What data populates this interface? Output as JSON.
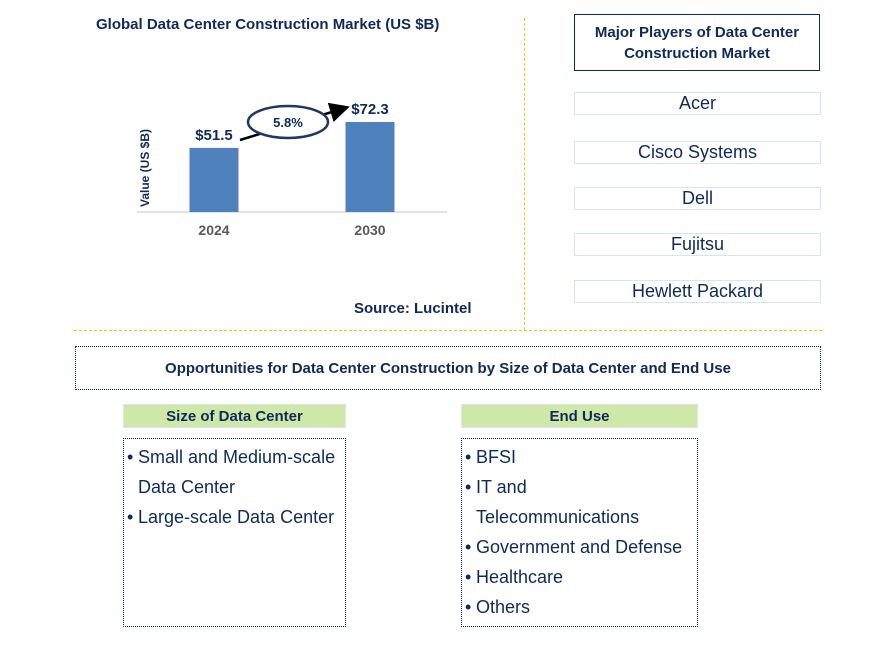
{
  "chart_data": {
    "type": "bar",
    "title": "Global Data Center Construction Market (US $B)",
    "xlabel": "",
    "ylabel": "Value (US $B)",
    "categories": [
      "2024",
      "2030"
    ],
    "values": [
      51.5,
      72.3
    ],
    "data_labels": [
      "$51.5",
      "$72.3"
    ],
    "ylim": [
      0,
      80
    ],
    "grid": false,
    "bar_color": "#4f81bd",
    "annotation": {
      "text": "5.8%",
      "type": "CAGR arrow",
      "from": "2024",
      "to": "2030"
    },
    "source": "Source: Lucintel"
  },
  "players": {
    "title": "Major Players of Data Center Construction Market",
    "items": [
      "Acer",
      "Cisco Systems",
      "Dell",
      "Fujitsu",
      "Hewlett Packard"
    ]
  },
  "opportunities": {
    "title": "Opportunities for Data Center Construction by Size of Data Center and End Use",
    "categories": [
      {
        "header": "Size of Data Center",
        "items": [
          [
            "Small and Medium-scale",
            "Data Center"
          ],
          [
            "Large-scale Data Center"
          ]
        ]
      },
      {
        "header": "End Use",
        "items": [
          [
            "BFSI"
          ],
          [
            "IT and",
            "Telecommunications"
          ],
          [
            "Government and Defense"
          ],
          [
            "Healthcare"
          ],
          [
            "Others"
          ]
        ]
      }
    ]
  },
  "colors": {
    "text": "#0e2a5c",
    "bar": "#4f81bd",
    "divider": "#f5c026",
    "category_header_bg": "#cfe8a8"
  },
  "bullet": "•"
}
